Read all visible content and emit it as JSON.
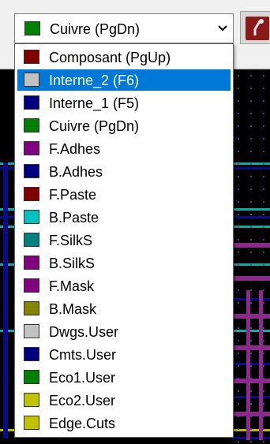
{
  "layer_selector": {
    "current": {
      "label": "Cuivre (PgDn)",
      "color": "#008000"
    },
    "items": [
      {
        "label": "Composant (PgUp)",
        "color": "#800000",
        "selected": false
      },
      {
        "label": "Interne_2 (F6)",
        "color": "#c2c2c2",
        "selected": true
      },
      {
        "label": "Interne_1 (F5)",
        "color": "#000080",
        "selected": false
      },
      {
        "label": "Cuivre (PgDn)",
        "color": "#008000",
        "selected": false
      },
      {
        "label": "F.Adhes",
        "color": "#800080",
        "selected": false
      },
      {
        "label": "B.Adhes",
        "color": "#000080",
        "selected": false
      },
      {
        "label": "F.Paste",
        "color": "#800000",
        "selected": false
      },
      {
        "label": "B.Paste",
        "color": "#00c2c2",
        "selected": false
      },
      {
        "label": "F.SilkS",
        "color": "#008080",
        "selected": false
      },
      {
        "label": "B.SilkS",
        "color": "#800080",
        "selected": false
      },
      {
        "label": "F.Mask",
        "color": "#800080",
        "selected": false
      },
      {
        "label": "B.Mask",
        "color": "#848400",
        "selected": false
      },
      {
        "label": "Dwgs.User",
        "color": "#c2c2c2",
        "selected": false
      },
      {
        "label": "Cmts.User",
        "color": "#000080",
        "selected": false
      },
      {
        "label": "Eco1.User",
        "color": "#008000",
        "selected": false
      },
      {
        "label": "Eco2.User",
        "color": "#c2c200",
        "selected": false
      },
      {
        "label": "Edge.Cuts",
        "color": "#c2c200",
        "selected": false
      }
    ]
  },
  "colors": {
    "selection_highlight": "#0078d7",
    "canvas_background": "#000000"
  },
  "icons": {
    "combo_arrow": "chevron-down-icon",
    "route_tool": "route-track-icon"
  }
}
